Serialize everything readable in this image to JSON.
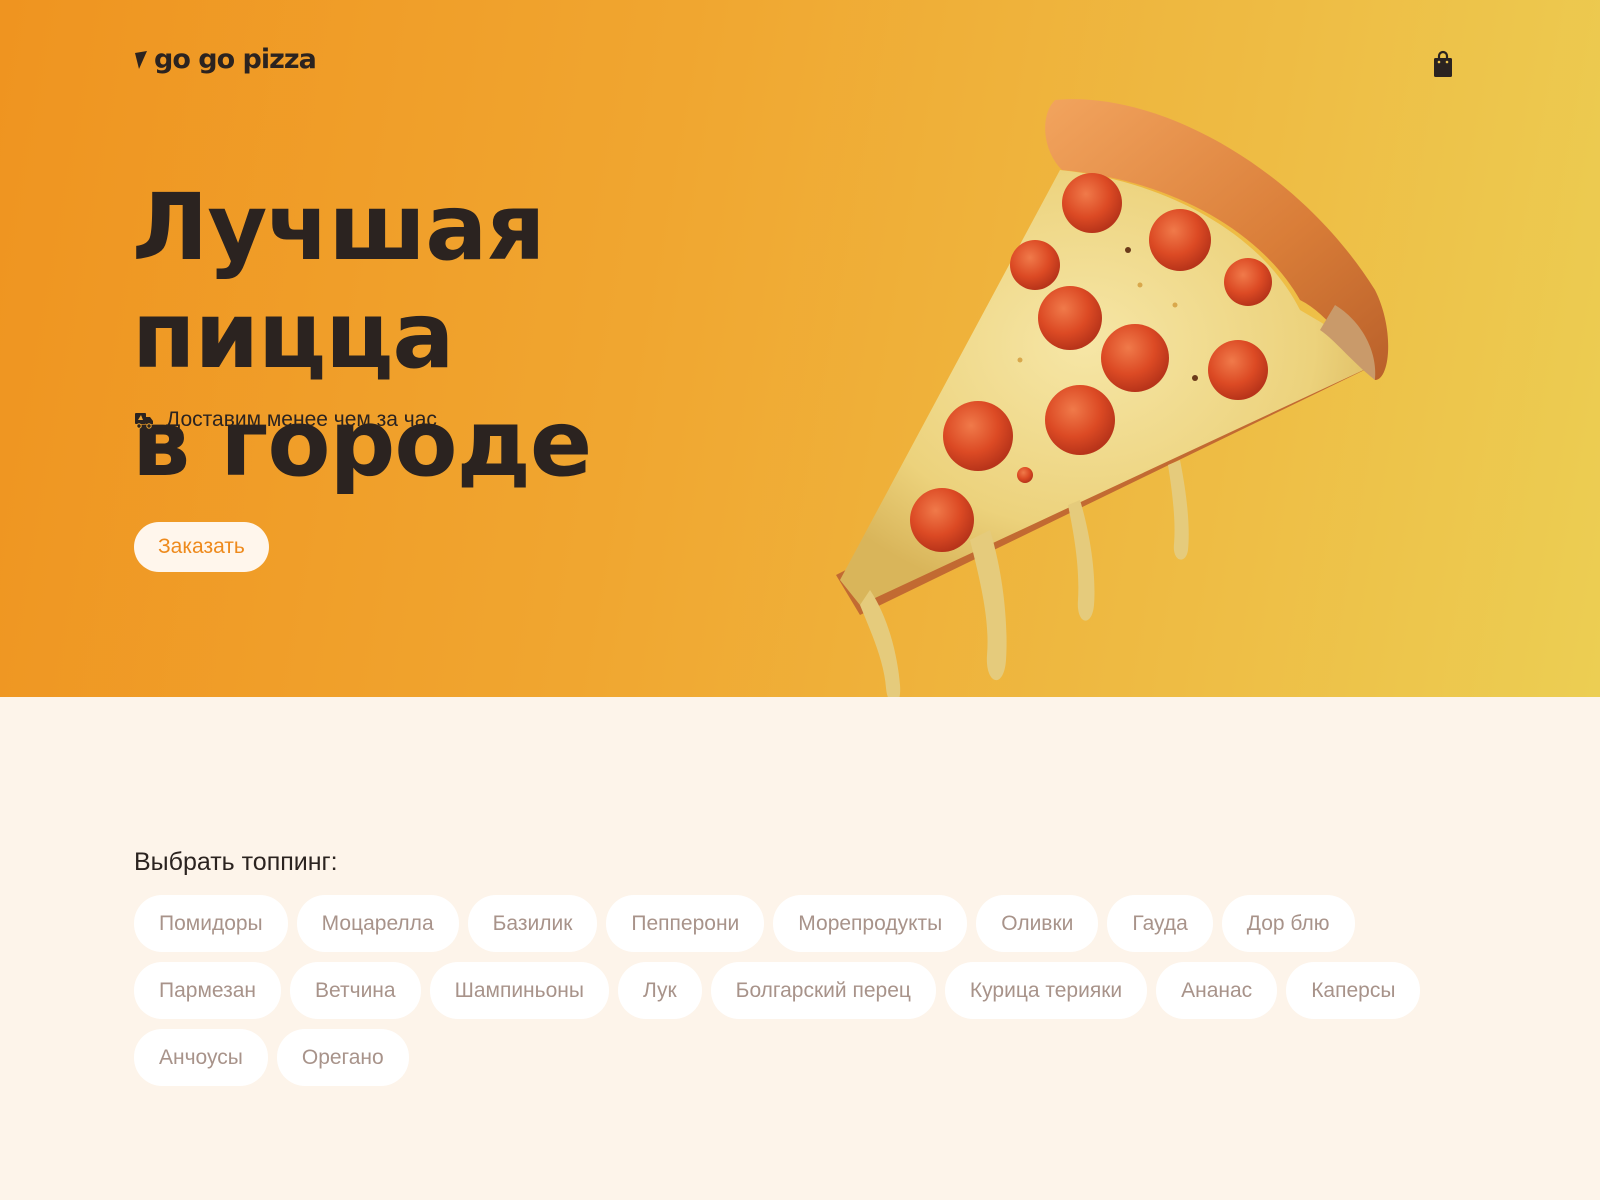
{
  "header": {
    "logo_text": "go go pizza",
    "cart_icon": "shopping-bag-icon"
  },
  "hero": {
    "title_line1": "Лучшая пицца",
    "title_line2": "в городе",
    "delivery_icon": "delivery-truck-icon",
    "delivery_text": "Доставим менее чем за час",
    "order_button": "Заказать",
    "image": "pepperoni-pizza-slice"
  },
  "toppings": {
    "title": "Выбрать топпинг:",
    "items": [
      "Помидоры",
      "Моцарелла",
      "Базилик",
      "Пепперони",
      "Морепродукты",
      "Оливки",
      "Гауда",
      "Дор блю",
      "Пармезан",
      "Ветчина",
      "Шампиньоны",
      "Лук",
      "Болгарский перец",
      "Курица терияки",
      "Ананас",
      "Каперсы",
      "Анчоусы",
      "Орегано"
    ]
  },
  "colors": {
    "accent": "#ee8a1c",
    "text_dark": "#2b2320",
    "chip_text": "#a8938a",
    "page_bg": "#fdf4ea"
  }
}
